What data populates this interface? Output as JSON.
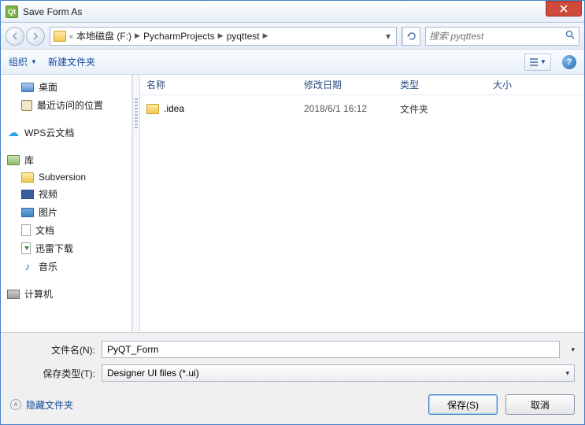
{
  "window": {
    "title": "Save Form As",
    "app_icon_text": "Qt"
  },
  "breadcrumbs": {
    "prefix": "«",
    "seg1": "本地磁盘 (F:)",
    "seg2": "PycharmProjects",
    "seg3": "pyqttest"
  },
  "search": {
    "placeholder": "搜索 pyqttest"
  },
  "toolbar": {
    "organize": "组织",
    "new_folder": "新建文件夹"
  },
  "columns": {
    "name": "名称",
    "date": "修改日期",
    "type": "类型",
    "size": "大小"
  },
  "sidebar": {
    "desktop": "桌面",
    "recent": "最近访问的位置",
    "wps": "WPS云文档",
    "library": "库",
    "subversion": "Subversion",
    "video": "视频",
    "pictures": "图片",
    "documents": "文档",
    "thunder": "迅雷下载",
    "music": "音乐",
    "computer": "计算机"
  },
  "files": {
    "row0": {
      "name": ".idea",
      "date": "2018/6/1 16:12",
      "type": "文件夹"
    }
  },
  "form": {
    "filename_label": "文件名(N):",
    "filename_value": "PyQT_Form",
    "filetype_label": "保存类型(T):",
    "filetype_value": "Designer UI files (*.ui)"
  },
  "footer": {
    "hide_folders": "隐藏文件夹",
    "save": "保存(S)",
    "cancel": "取消"
  }
}
